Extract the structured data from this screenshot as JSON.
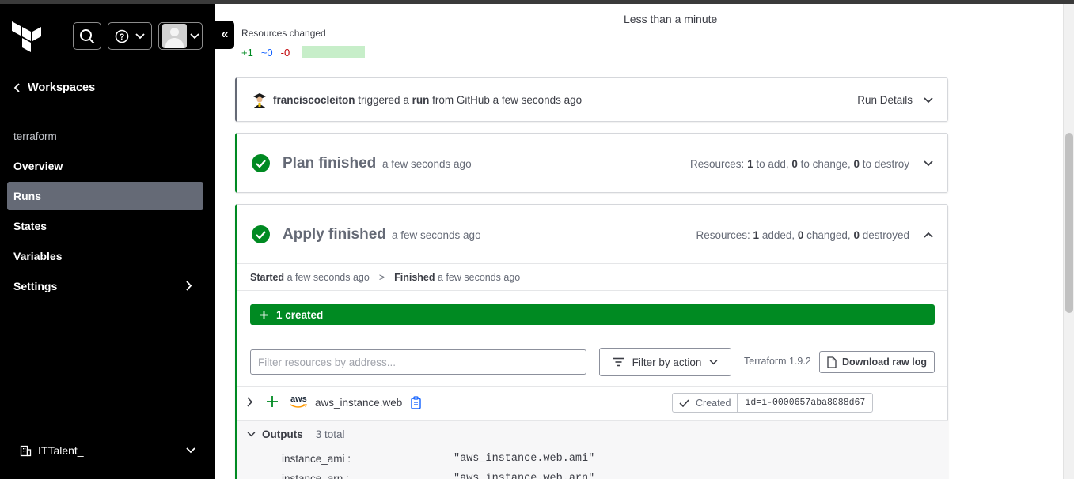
{
  "sidebar": {
    "back_label": "Workspaces",
    "workspace_name": "terraform",
    "nav": [
      {
        "label": "Overview"
      },
      {
        "label": "Runs"
      },
      {
        "label": "States"
      },
      {
        "label": "Variables"
      },
      {
        "label": "Settings"
      }
    ],
    "org_name": "ITTalent_"
  },
  "run": {
    "duration": "Less than a minute",
    "resources_changed_label": "Resources changed",
    "changed_add": "+1",
    "changed_change": "~0",
    "changed_destroy": "-0",
    "trigger": {
      "user": "franciscocleiton",
      "text_1": " triggered a ",
      "run_word": "run",
      "text_2": " from GitHub a few seconds ago"
    },
    "run_details_label": "Run Details"
  },
  "plan": {
    "title": "Plan finished",
    "time": "a few seconds ago",
    "res_prefix": "Resources: ",
    "add": "1",
    "add_suffix": " to add, ",
    "change": "0",
    "change_suffix": " to change, ",
    "destroy": "0",
    "destroy_suffix": " to destroy"
  },
  "apply": {
    "title": "Apply finished",
    "time": "a few seconds ago",
    "res_prefix": "Resources: ",
    "added": "1",
    "added_suffix": " added, ",
    "changed": "0",
    "changed_suffix": " changed, ",
    "destroyed": "0",
    "destroyed_suffix": " destroyed",
    "started_label": "Started",
    "started_time": "a few seconds ago",
    "finished_label": "Finished",
    "finished_time": "a few seconds ago",
    "created_summary": "1 created",
    "filter_placeholder": "Filter resources by address...",
    "filter_action_label": "Filter by action",
    "terraform_version": "Terraform 1.9.2",
    "download_label": "Download raw log",
    "resource": {
      "provider": "aws",
      "name": "aws_instance.web",
      "status": "Created",
      "id": "id=i-0000657aba8088d67"
    },
    "outputs": {
      "label": "Outputs",
      "count": "3 total",
      "rows": [
        {
          "key": "instance_ami :",
          "value": "\"aws_instance.web.ami\""
        },
        {
          "key": "instance_arn :",
          "value": "\"aws_instance.web.arn\""
        }
      ]
    }
  },
  "colors": {
    "success": "#008a22",
    "sidebar_bg": "#000000",
    "nav_active": "#656a76",
    "add_green": "#008a22",
    "change_blue": "#1060ff",
    "destroy_red": "#c00005"
  }
}
